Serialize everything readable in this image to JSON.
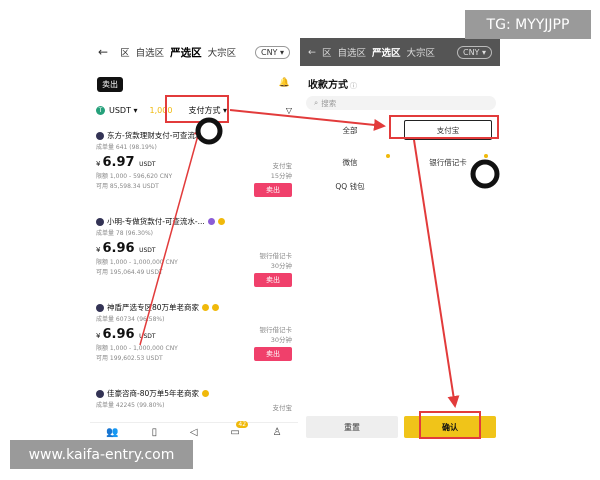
{
  "watermarks": {
    "tg": "TG: MYYJJPP",
    "site": "www.kaifa-entry.com"
  },
  "left": {
    "nav": {
      "back": "←",
      "tabs": [
        "区",
        "自选区",
        "严选区",
        "大宗区"
      ],
      "active_tab": "严选区",
      "currency": "CNY ▾"
    },
    "sell_label": "卖出",
    "filters": {
      "coin": "USDT ▾",
      "amount": "1,000",
      "payment": "支付方式 ▾"
    },
    "listings": [
      {
        "name": "东方-货款理财支付-可查流水",
        "stats": "成单量 641 (98.19%)",
        "price": "6.97",
        "unit": "USDT",
        "limit": "限额 1,000 - 596,620 CNY",
        "available": "可用 85,598.34 USDT",
        "payment": "支付宝",
        "time": "15分钟",
        "action": "卖出"
      },
      {
        "name": "小明-专做货款付-可查流水-...",
        "stats": "成单量 78 (96.30%)",
        "price": "6.96",
        "unit": "USDT",
        "limit": "限额 1,000 - 1,000,000 CNY",
        "available": "可用 195,064.49 USDT",
        "payment": "银行借记卡",
        "time": "30分钟",
        "action": "卖出"
      },
      {
        "name": "神盾严选专区80万单老商家",
        "stats": "成单量 60734 (96.58%)",
        "price": "6.96",
        "unit": "USDT",
        "limit": "限额 1,000 - 1,000,000 CNY",
        "available": "可用 199,602.53 USDT",
        "payment": "银行借记卡",
        "time": "30分钟",
        "action": "卖出"
      },
      {
        "name": "佳豪咨商-80万单5年老商家",
        "stats": "成单量 42245 (99.80%)",
        "price": "",
        "payment": "支付宝",
        "time": "",
        "action": ""
      }
    ],
    "bottom_nav_badge": "42"
  },
  "right": {
    "nav": {
      "back": "←",
      "tabs": [
        "区",
        "自选区",
        "严选区",
        "大宗区"
      ],
      "active_tab": "严选区",
      "currency": "CNY ▾"
    },
    "sheet_title": "收款方式",
    "search_placeholder": "搜索",
    "options": [
      "全部",
      "支付宝",
      "微信",
      "银行借记卡",
      "QQ 钱包"
    ],
    "reset": "重置",
    "confirm": "确认"
  }
}
